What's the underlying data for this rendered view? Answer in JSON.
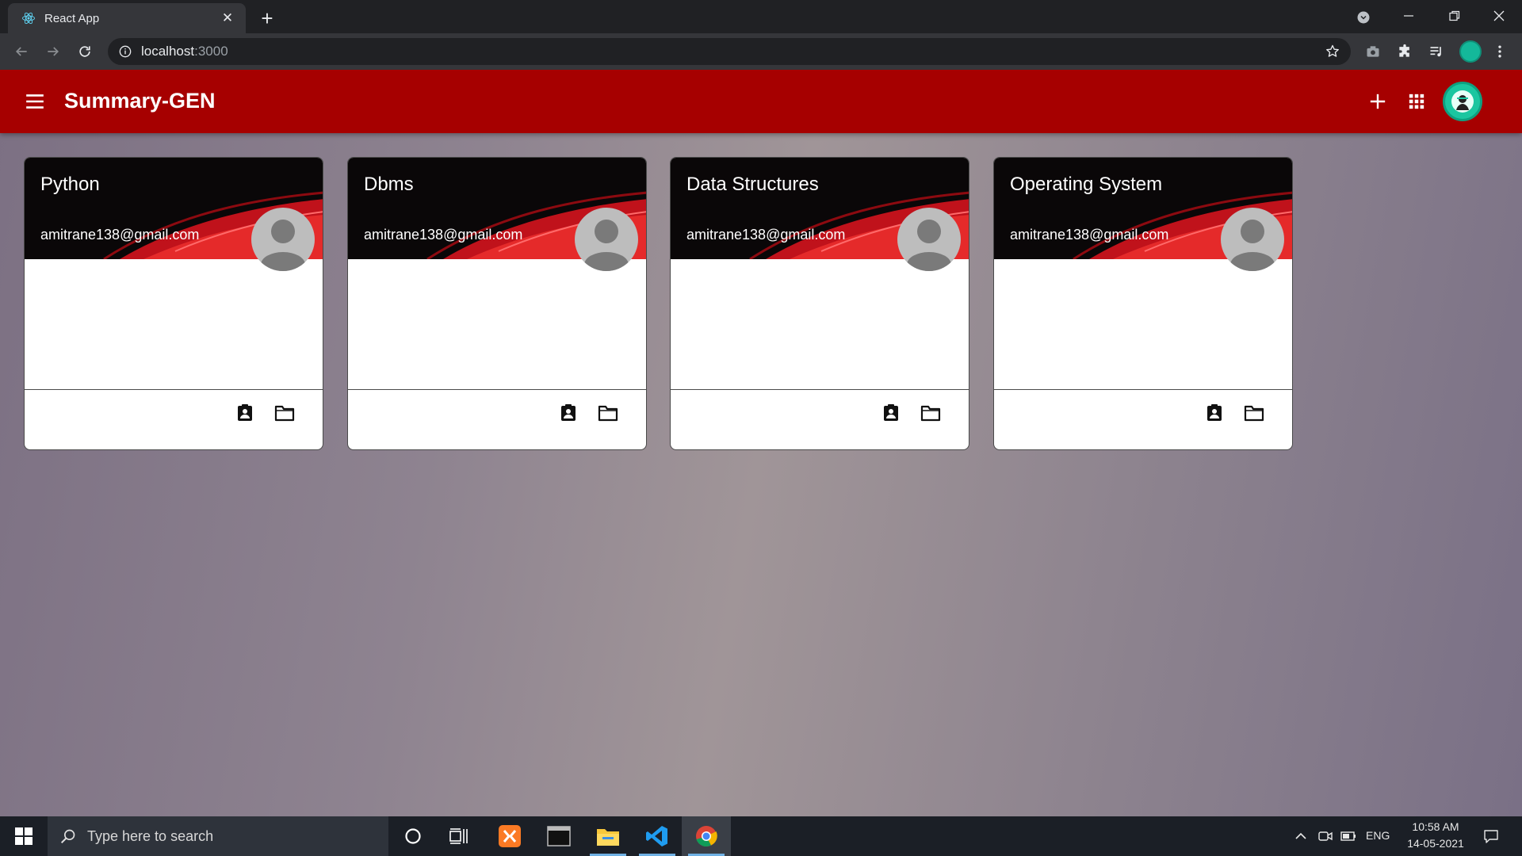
{
  "browser": {
    "tab_title": "React App",
    "tab_close": "✕",
    "new_tab": "+",
    "url_host": "localhost",
    "url_port": ":3000"
  },
  "app": {
    "title": "Summary-GEN",
    "header_color": "#a60000"
  },
  "classes": [
    {
      "name": "Python",
      "email": "amitrane138@gmail.com"
    },
    {
      "name": "Dbms",
      "email": "amitrane138@gmail.com"
    },
    {
      "name": "Data Structures",
      "email": "amitrane138@gmail.com"
    },
    {
      "name": "Operating System",
      "email": "amitrane138@gmail.com"
    }
  ],
  "taskbar": {
    "search_placeholder": "Type here to search",
    "language": "ENG",
    "time": "10:58 AM",
    "date": "14-05-2021"
  },
  "icons": {
    "card_icons": [
      "assignment-ind-icon",
      "folder-icon"
    ],
    "appbar": [
      "menu-icon",
      "add-icon",
      "apps-grid-icon"
    ]
  }
}
